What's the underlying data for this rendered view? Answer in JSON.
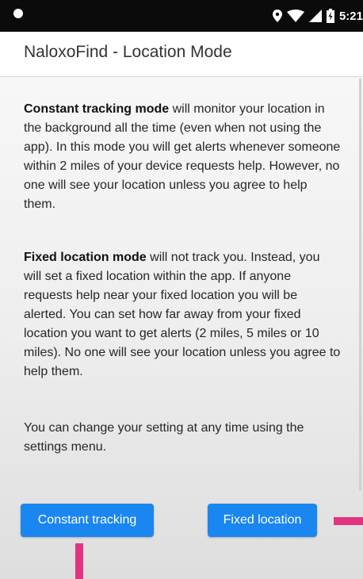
{
  "status_bar": {
    "time": "5:21"
  },
  "app_bar": {
    "title": "NaloxoFind - Location Mode"
  },
  "content": {
    "paragraph1": {
      "bold": "Constant tracking mode",
      "text": " will monitor your location in the background all the time (even when not using the app). In this mode you will get alerts whenever someone within 2 miles of your device requests help. However, no one will see your location unless you agree to help them."
    },
    "paragraph2": {
      "bold": "Fixed location mode",
      "text": " will not track you. Instead, you will set a fixed location within the app. If anyone requests help near your fixed location you will be alerted. You can set how far away from your fixed location you want to get alerts (2 miles, 5 miles or 10 miles). No one will see your location unless you agree to help them."
    },
    "paragraph3": {
      "text": "You can change your setting at any time using the settings menu."
    }
  },
  "buttons": {
    "constant_tracking": "Constant tracking",
    "fixed_location": "Fixed location"
  },
  "colors": {
    "button": "#1a86f0",
    "annotation": "#e2347f",
    "status_bar": "#0b0b0b"
  }
}
